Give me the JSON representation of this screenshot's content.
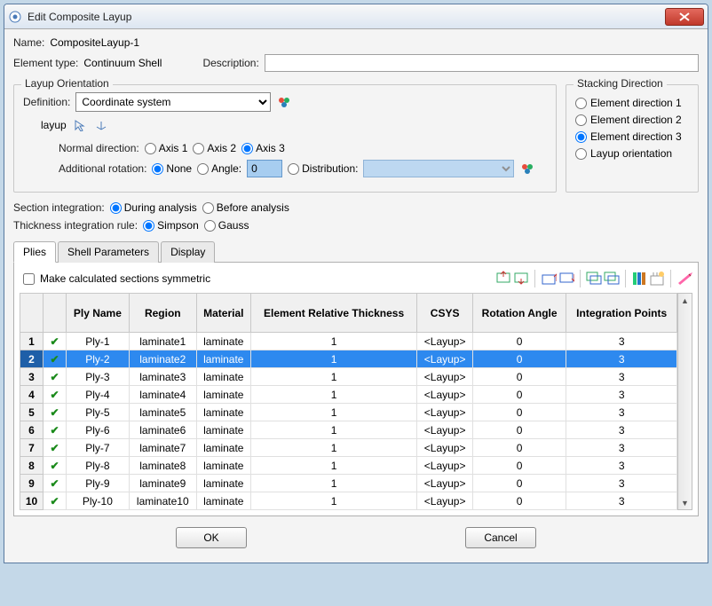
{
  "window": {
    "title": "Edit Composite Layup"
  },
  "header": {
    "name_label": "Name:",
    "name_value": "CompositeLayup-1",
    "elemtype_label": "Element type:",
    "elemtype_value": "Continuum Shell",
    "description_label": "Description:",
    "description_value": ""
  },
  "layup": {
    "legend": "Layup Orientation",
    "definition_label": "Definition:",
    "definition_value": "Coordinate system",
    "part_label": "layup",
    "normal_label": "Normal direction:",
    "axis1": "Axis 1",
    "axis2": "Axis 2",
    "axis3": "Axis 3",
    "normal_selected": "axis3",
    "addrot_label": "Additional rotation:",
    "rot_none": "None",
    "rot_angle": "Angle:",
    "rot_angle_value": "0",
    "rot_dist": "Distribution:",
    "rot_selected": "none"
  },
  "stacking": {
    "legend": "Stacking Direction",
    "opt1": "Element direction 1",
    "opt2": "Element direction 2",
    "opt3": "Element direction 3",
    "opt4": "Layup orientation",
    "selected": "opt3"
  },
  "section_integration": {
    "label": "Section integration:",
    "during": "During analysis",
    "before": "Before analysis",
    "selected": "during"
  },
  "thickness_rule": {
    "label": "Thickness integration rule:",
    "simpson": "Simpson",
    "gauss": "Gauss",
    "selected": "simpson"
  },
  "tabs": {
    "plies": "Plies",
    "shell": "Shell Parameters",
    "display": "Display",
    "active": "plies"
  },
  "plies_tab": {
    "symmetric_label": "Make calculated sections symmetric",
    "columns": {
      "check": "",
      "plyname": "Ply Name",
      "region": "Region",
      "material": "Material",
      "thickness": "Element Relative Thickness",
      "csys": "CSYS",
      "angle": "Rotation Angle",
      "intpts": "Integration Points"
    },
    "rows": [
      {
        "n": "1",
        "chk": true,
        "name": "Ply-1",
        "region": "laminate1",
        "material": "laminate",
        "thick": "1",
        "csys": "<Layup>",
        "angle": "0",
        "ip": "3",
        "sel": false
      },
      {
        "n": "2",
        "chk": true,
        "name": "Ply-2",
        "region": "laminate2",
        "material": "laminate",
        "thick": "1",
        "csys": "<Layup>",
        "angle": "0",
        "ip": "3",
        "sel": true
      },
      {
        "n": "3",
        "chk": true,
        "name": "Ply-3",
        "region": "laminate3",
        "material": "laminate",
        "thick": "1",
        "csys": "<Layup>",
        "angle": "0",
        "ip": "3",
        "sel": false
      },
      {
        "n": "4",
        "chk": true,
        "name": "Ply-4",
        "region": "laminate4",
        "material": "laminate",
        "thick": "1",
        "csys": "<Layup>",
        "angle": "0",
        "ip": "3",
        "sel": false
      },
      {
        "n": "5",
        "chk": true,
        "name": "Ply-5",
        "region": "laminate5",
        "material": "laminate",
        "thick": "1",
        "csys": "<Layup>",
        "angle": "0",
        "ip": "3",
        "sel": false
      },
      {
        "n": "6",
        "chk": true,
        "name": "Ply-6",
        "region": "laminate6",
        "material": "laminate",
        "thick": "1",
        "csys": "<Layup>",
        "angle": "0",
        "ip": "3",
        "sel": false
      },
      {
        "n": "7",
        "chk": true,
        "name": "Ply-7",
        "region": "laminate7",
        "material": "laminate",
        "thick": "1",
        "csys": "<Layup>",
        "angle": "0",
        "ip": "3",
        "sel": false
      },
      {
        "n": "8",
        "chk": true,
        "name": "Ply-8",
        "region": "laminate8",
        "material": "laminate",
        "thick": "1",
        "csys": "<Layup>",
        "angle": "0",
        "ip": "3",
        "sel": false
      },
      {
        "n": "9",
        "chk": true,
        "name": "Ply-9",
        "region": "laminate9",
        "material": "laminate",
        "thick": "1",
        "csys": "<Layup>",
        "angle": "0",
        "ip": "3",
        "sel": false
      },
      {
        "n": "10",
        "chk": true,
        "name": "Ply-10",
        "region": "laminate10",
        "material": "laminate",
        "thick": "1",
        "csys": "<Layup>",
        "angle": "0",
        "ip": "3",
        "sel": false
      }
    ]
  },
  "buttons": {
    "ok": "OK",
    "cancel": "Cancel"
  }
}
